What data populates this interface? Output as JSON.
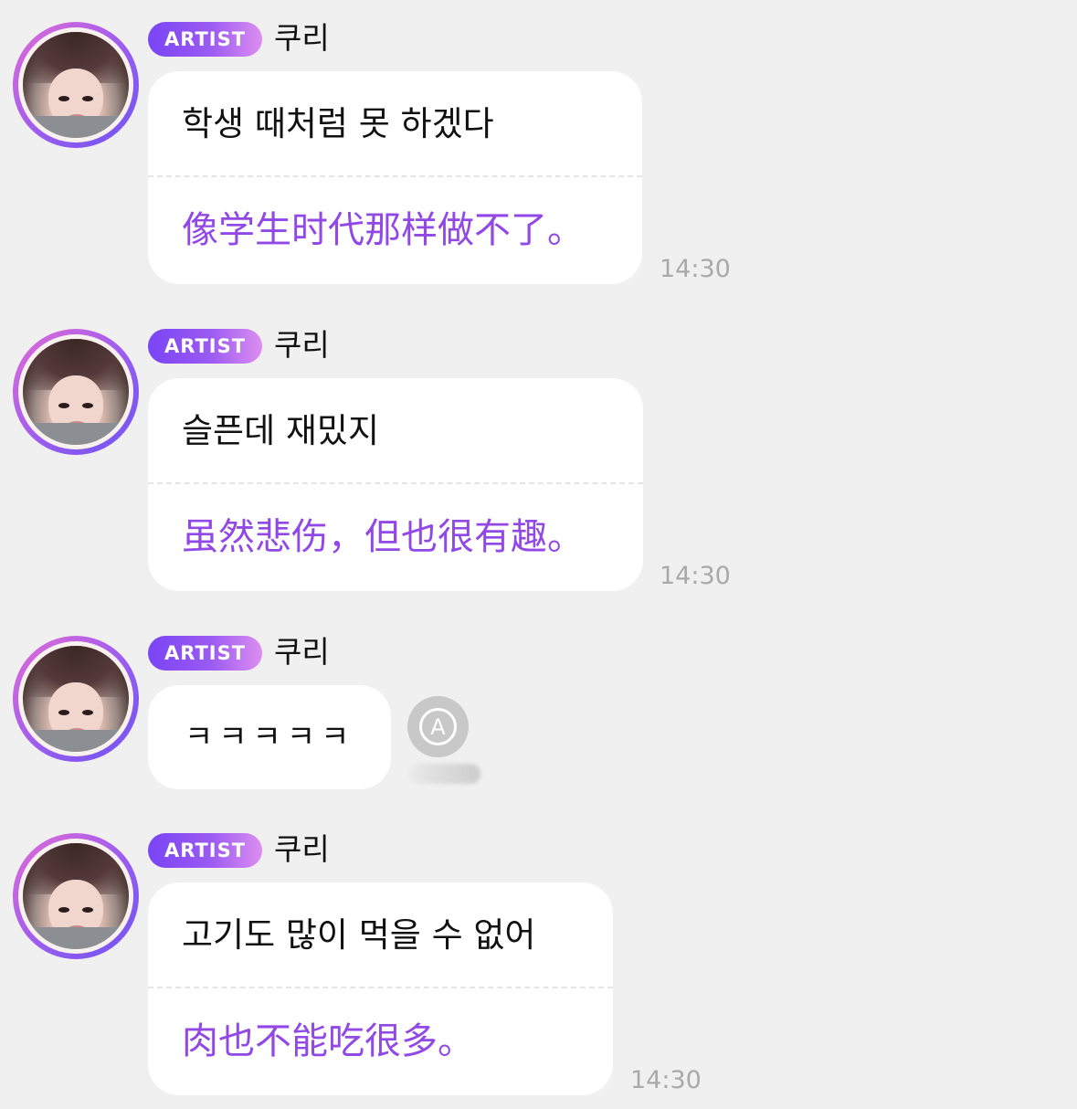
{
  "messages": [
    {
      "badge": "ARTIST",
      "name": "쿠리",
      "original": "학생 때처럼 못 하겠다",
      "translation": "像学生时代那样做不了。",
      "time": "14:30"
    },
    {
      "badge": "ARTIST",
      "name": "쿠리",
      "original": "슬픈데 재밌지",
      "translation": "虽然悲伤，但也很有趣。",
      "time": "14:30"
    },
    {
      "badge": "ARTIST",
      "name": "쿠리",
      "original": "ㅋㅋㅋㅋㅋ",
      "translate_button_icon": "A",
      "translate_icon_name": "auto-translate-icon"
    },
    {
      "badge": "ARTIST",
      "name": "쿠리",
      "original": "고기도 많이 먹을 수 없어",
      "translation": "肉也不能吃很多。",
      "time": "14:30"
    }
  ],
  "colors": {
    "background": "#f0f0f0",
    "bubble": "#ffffff",
    "translation_text": "#9148e6",
    "badge_gradient": [
      "#7a45f5",
      "#dd8ef0"
    ],
    "timestamp": "#a9a9a9"
  }
}
